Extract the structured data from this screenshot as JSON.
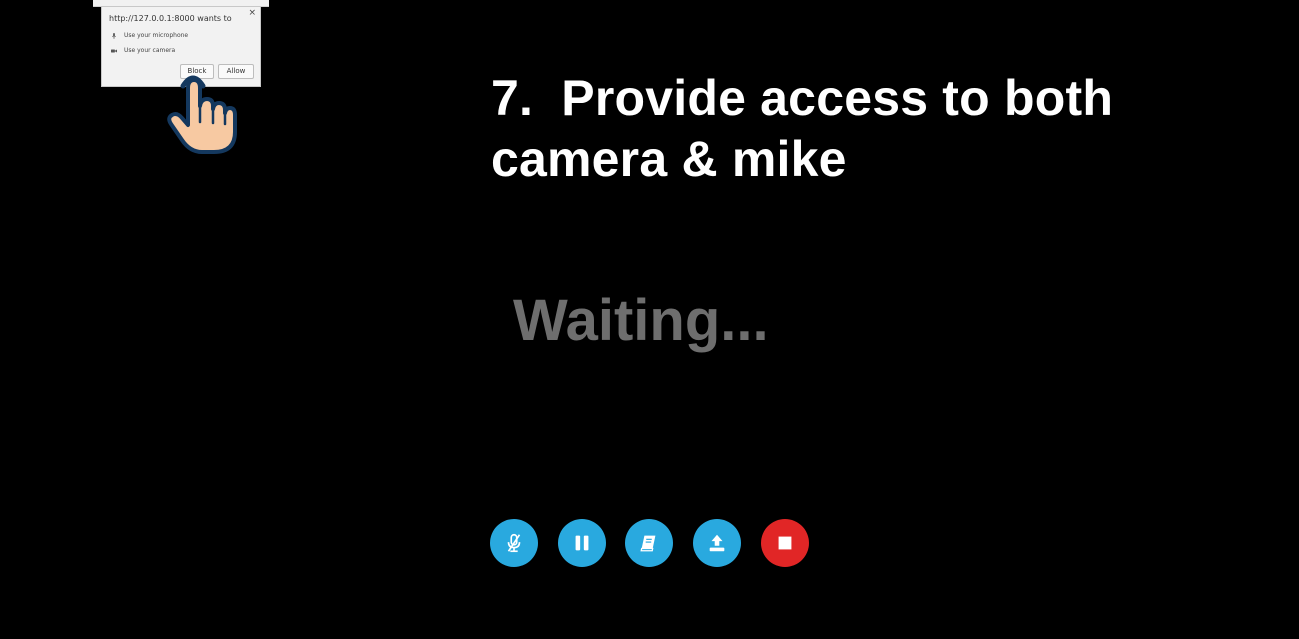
{
  "popup": {
    "title": "http://127.0.0.1:8000 wants to",
    "close_glyph": "×",
    "permissions": [
      {
        "icon": "microphone-icon",
        "label": "Use your microphone"
      },
      {
        "icon": "camera-icon",
        "label": "Use your camera"
      }
    ],
    "block_label": "Block",
    "allow_label": "Allow"
  },
  "headline": {
    "line1": "7.  Provide access to both",
    "line2": "camera & mike"
  },
  "status": {
    "text": "Waiting..."
  },
  "toolbar": {
    "buttons": [
      {
        "name": "mute-microphone",
        "icon": "microphone-slash-icon",
        "color": "#29a9df"
      },
      {
        "name": "pause",
        "icon": "pause-icon",
        "color": "#29a9df"
      },
      {
        "name": "notes",
        "icon": "book-icon",
        "color": "#29a9df"
      },
      {
        "name": "upload",
        "icon": "upload-icon",
        "color": "#29a9df"
      },
      {
        "name": "stop",
        "icon": "stop-icon",
        "color": "#e12626"
      }
    ]
  },
  "overlay": {
    "pointer_icon": "hand-pointer-icon"
  }
}
